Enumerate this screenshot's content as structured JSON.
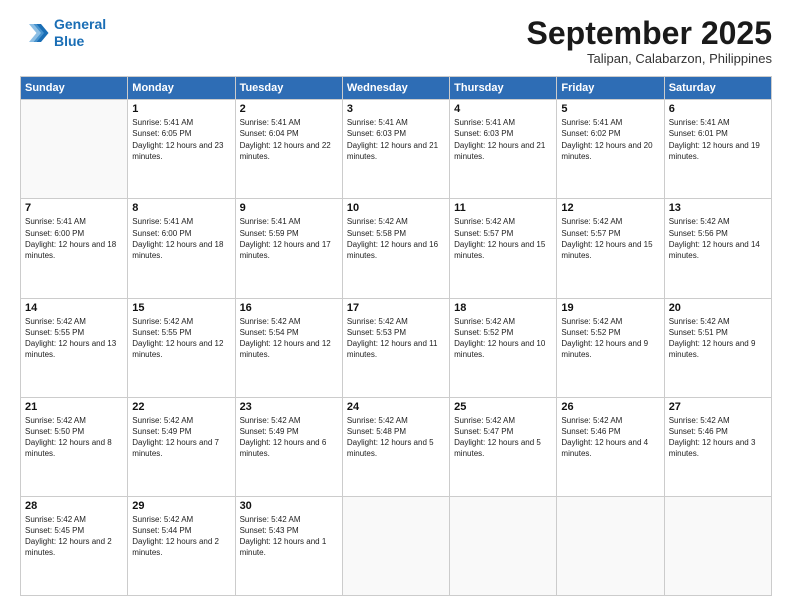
{
  "logo": {
    "line1": "General",
    "line2": "Blue"
  },
  "title": "September 2025",
  "location": "Talipan, Calabarzon, Philippines",
  "days_header": [
    "Sunday",
    "Monday",
    "Tuesday",
    "Wednesday",
    "Thursday",
    "Friday",
    "Saturday"
  ],
  "weeks": [
    [
      {
        "day": "",
        "sunrise": "",
        "sunset": "",
        "daylight": ""
      },
      {
        "day": "1",
        "sunrise": "Sunrise: 5:41 AM",
        "sunset": "Sunset: 6:05 PM",
        "daylight": "Daylight: 12 hours and 23 minutes."
      },
      {
        "day": "2",
        "sunrise": "Sunrise: 5:41 AM",
        "sunset": "Sunset: 6:04 PM",
        "daylight": "Daylight: 12 hours and 22 minutes."
      },
      {
        "day": "3",
        "sunrise": "Sunrise: 5:41 AM",
        "sunset": "Sunset: 6:03 PM",
        "daylight": "Daylight: 12 hours and 21 minutes."
      },
      {
        "day": "4",
        "sunrise": "Sunrise: 5:41 AM",
        "sunset": "Sunset: 6:03 PM",
        "daylight": "Daylight: 12 hours and 21 minutes."
      },
      {
        "day": "5",
        "sunrise": "Sunrise: 5:41 AM",
        "sunset": "Sunset: 6:02 PM",
        "daylight": "Daylight: 12 hours and 20 minutes."
      },
      {
        "day": "6",
        "sunrise": "Sunrise: 5:41 AM",
        "sunset": "Sunset: 6:01 PM",
        "daylight": "Daylight: 12 hours and 19 minutes."
      }
    ],
    [
      {
        "day": "7",
        "sunrise": "Sunrise: 5:41 AM",
        "sunset": "Sunset: 6:00 PM",
        "daylight": "Daylight: 12 hours and 18 minutes."
      },
      {
        "day": "8",
        "sunrise": "Sunrise: 5:41 AM",
        "sunset": "Sunset: 6:00 PM",
        "daylight": "Daylight: 12 hours and 18 minutes."
      },
      {
        "day": "9",
        "sunrise": "Sunrise: 5:41 AM",
        "sunset": "Sunset: 5:59 PM",
        "daylight": "Daylight: 12 hours and 17 minutes."
      },
      {
        "day": "10",
        "sunrise": "Sunrise: 5:42 AM",
        "sunset": "Sunset: 5:58 PM",
        "daylight": "Daylight: 12 hours and 16 minutes."
      },
      {
        "day": "11",
        "sunrise": "Sunrise: 5:42 AM",
        "sunset": "Sunset: 5:57 PM",
        "daylight": "Daylight: 12 hours and 15 minutes."
      },
      {
        "day": "12",
        "sunrise": "Sunrise: 5:42 AM",
        "sunset": "Sunset: 5:57 PM",
        "daylight": "Daylight: 12 hours and 15 minutes."
      },
      {
        "day": "13",
        "sunrise": "Sunrise: 5:42 AM",
        "sunset": "Sunset: 5:56 PM",
        "daylight": "Daylight: 12 hours and 14 minutes."
      }
    ],
    [
      {
        "day": "14",
        "sunrise": "Sunrise: 5:42 AM",
        "sunset": "Sunset: 5:55 PM",
        "daylight": "Daylight: 12 hours and 13 minutes."
      },
      {
        "day": "15",
        "sunrise": "Sunrise: 5:42 AM",
        "sunset": "Sunset: 5:55 PM",
        "daylight": "Daylight: 12 hours and 12 minutes."
      },
      {
        "day": "16",
        "sunrise": "Sunrise: 5:42 AM",
        "sunset": "Sunset: 5:54 PM",
        "daylight": "Daylight: 12 hours and 12 minutes."
      },
      {
        "day": "17",
        "sunrise": "Sunrise: 5:42 AM",
        "sunset": "Sunset: 5:53 PM",
        "daylight": "Daylight: 12 hours and 11 minutes."
      },
      {
        "day": "18",
        "sunrise": "Sunrise: 5:42 AM",
        "sunset": "Sunset: 5:52 PM",
        "daylight": "Daylight: 12 hours and 10 minutes."
      },
      {
        "day": "19",
        "sunrise": "Sunrise: 5:42 AM",
        "sunset": "Sunset: 5:52 PM",
        "daylight": "Daylight: 12 hours and 9 minutes."
      },
      {
        "day": "20",
        "sunrise": "Sunrise: 5:42 AM",
        "sunset": "Sunset: 5:51 PM",
        "daylight": "Daylight: 12 hours and 9 minutes."
      }
    ],
    [
      {
        "day": "21",
        "sunrise": "Sunrise: 5:42 AM",
        "sunset": "Sunset: 5:50 PM",
        "daylight": "Daylight: 12 hours and 8 minutes."
      },
      {
        "day": "22",
        "sunrise": "Sunrise: 5:42 AM",
        "sunset": "Sunset: 5:49 PM",
        "daylight": "Daylight: 12 hours and 7 minutes."
      },
      {
        "day": "23",
        "sunrise": "Sunrise: 5:42 AM",
        "sunset": "Sunset: 5:49 PM",
        "daylight": "Daylight: 12 hours and 6 minutes."
      },
      {
        "day": "24",
        "sunrise": "Sunrise: 5:42 AM",
        "sunset": "Sunset: 5:48 PM",
        "daylight": "Daylight: 12 hours and 5 minutes."
      },
      {
        "day": "25",
        "sunrise": "Sunrise: 5:42 AM",
        "sunset": "Sunset: 5:47 PM",
        "daylight": "Daylight: 12 hours and 5 minutes."
      },
      {
        "day": "26",
        "sunrise": "Sunrise: 5:42 AM",
        "sunset": "Sunset: 5:46 PM",
        "daylight": "Daylight: 12 hours and 4 minutes."
      },
      {
        "day": "27",
        "sunrise": "Sunrise: 5:42 AM",
        "sunset": "Sunset: 5:46 PM",
        "daylight": "Daylight: 12 hours and 3 minutes."
      }
    ],
    [
      {
        "day": "28",
        "sunrise": "Sunrise: 5:42 AM",
        "sunset": "Sunset: 5:45 PM",
        "daylight": "Daylight: 12 hours and 2 minutes."
      },
      {
        "day": "29",
        "sunrise": "Sunrise: 5:42 AM",
        "sunset": "Sunset: 5:44 PM",
        "daylight": "Daylight: 12 hours and 2 minutes."
      },
      {
        "day": "30",
        "sunrise": "Sunrise: 5:42 AM",
        "sunset": "Sunset: 5:43 PM",
        "daylight": "Daylight: 12 hours and 1 minute."
      },
      {
        "day": "",
        "sunrise": "",
        "sunset": "",
        "daylight": ""
      },
      {
        "day": "",
        "sunrise": "",
        "sunset": "",
        "daylight": ""
      },
      {
        "day": "",
        "sunrise": "",
        "sunset": "",
        "daylight": ""
      },
      {
        "day": "",
        "sunrise": "",
        "sunset": "",
        "daylight": ""
      }
    ]
  ]
}
